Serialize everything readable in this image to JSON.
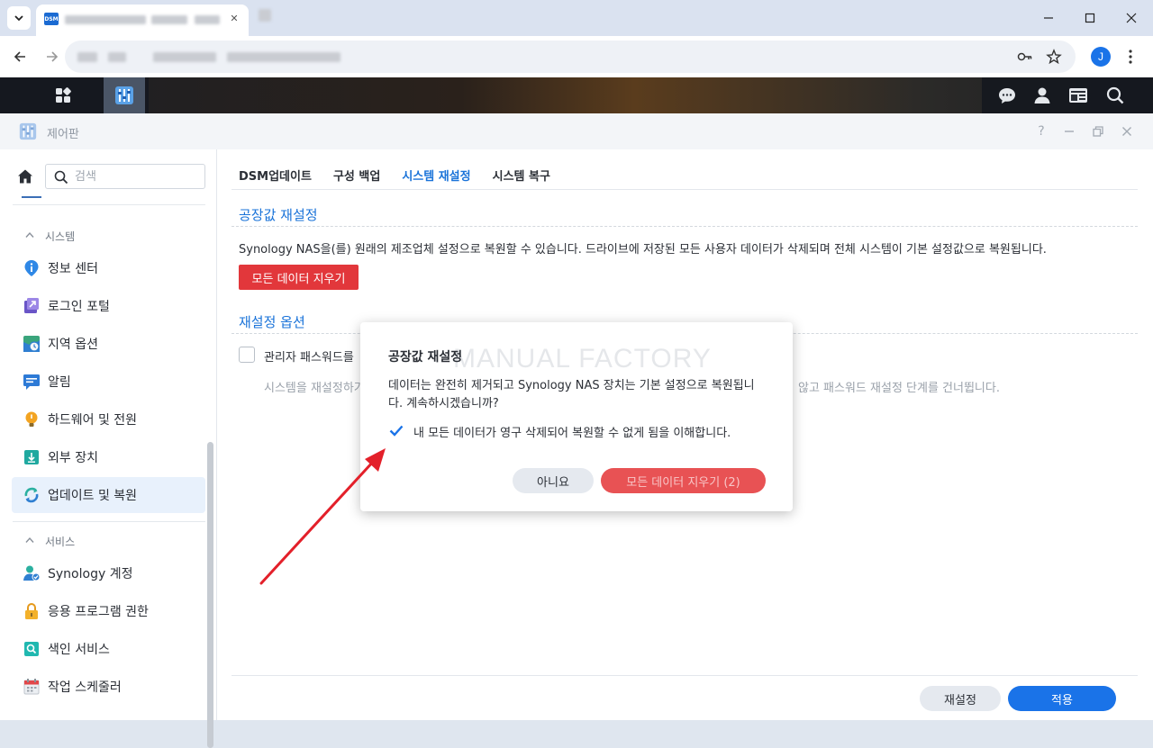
{
  "browser": {
    "tab_favicon": "DSM",
    "profile_initial": "J"
  },
  "window": {
    "title": "제어판"
  },
  "sidebar": {
    "search_placeholder": "검색",
    "sections": [
      {
        "label": "시스템",
        "items": [
          {
            "label": "정보 센터",
            "icon": "info-icon"
          },
          {
            "label": "로그인 포털",
            "icon": "login-portal-icon"
          },
          {
            "label": "지역 옵션",
            "icon": "regional-options-icon"
          },
          {
            "label": "알림",
            "icon": "notification-icon"
          },
          {
            "label": "하드웨어 및 전원",
            "icon": "hardware-power-icon"
          },
          {
            "label": "외부 장치",
            "icon": "external-devices-icon"
          },
          {
            "label": "업데이트 및 복원",
            "icon": "update-restore-icon",
            "active": true
          }
        ]
      },
      {
        "label": "서비스",
        "items": [
          {
            "label": "Synology 계정",
            "icon": "synology-account-icon"
          },
          {
            "label": "응용 프로그램 권한",
            "icon": "lock-icon"
          },
          {
            "label": "색인 서비스",
            "icon": "indexing-service-icon"
          },
          {
            "label": "작업 스케줄러",
            "icon": "calendar-icon"
          }
        ]
      }
    ]
  },
  "content": {
    "tabs": [
      {
        "label": "DSM업데이트",
        "active": false
      },
      {
        "label": "구성 백업",
        "active": false
      },
      {
        "label": "시스템 재설정",
        "active": true
      },
      {
        "label": "시스템 복구",
        "active": false
      }
    ],
    "factory_reset": {
      "title": "공장값 재설정",
      "description": "Synology NAS을(를) 원래의 제조업체 설정으로 복원할 수 있습니다. 드라이브에 저장된 모든 사용자 데이터가 삭제되며 전체 시스템이 기본 설정값으로 복원됩니다.",
      "erase_button": "모든 데이터 지우기"
    },
    "reset_options": {
      "title": "재설정 옵션",
      "admin_checkbox_label": "관리자 패스워드를 ",
      "help_left": "시스템을 재설정하기",
      "help_right": "않고 패스워드 재설정 단계를 건너뜁니다."
    },
    "footer": {
      "reset_button": "재설정",
      "apply_button": "적용"
    }
  },
  "dialog": {
    "title": "공장값 재설정",
    "watermark": "MANUAL FACTORY",
    "message": "데이터는 완전히 제거되고 Synology NAS 장치는 기본 설정으로 복원됩니다. 계속하시겠습니까?",
    "confirm_checkbox_label": "내 모든 데이터가 영구 삭제되어 복원할 수 없게 됨을 이해합니다.",
    "confirm_checked": true,
    "no_button": "아니요",
    "erase_button": "모든 데이터 지우기 (2)"
  },
  "colors": {
    "accent": "#1a73e8",
    "danger": "#e2373b",
    "arrow": "#e3202a"
  }
}
